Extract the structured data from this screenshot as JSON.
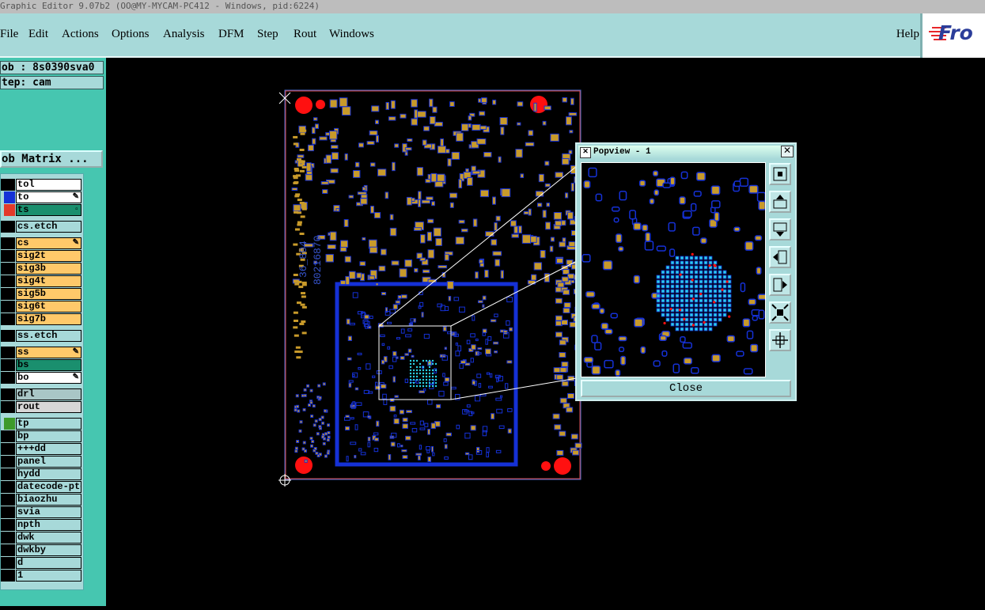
{
  "window": {
    "title": "Graphic Editor 9.07b2 (OO@MY-MYCAM-PC412 - Windows, pid:6224)"
  },
  "menu": {
    "items": [
      "File",
      "Edit",
      "Actions",
      "Options",
      "Analysis",
      "DFM",
      "Step",
      "Rout",
      "Windows"
    ],
    "help": "Help"
  },
  "logo": {
    "text": "Fro"
  },
  "job": {
    "name": "ob : 8s0390sva0",
    "step": "tep: cam",
    "matrix_button": "ob Matrix ..."
  },
  "layers": [
    {
      "name": "tol",
      "bg": "#ffffff",
      "swatch": "#000000"
    },
    {
      "name": "to",
      "bg": "#ffffff",
      "swatch": "#1531d6",
      "mark": "✎"
    },
    {
      "name": "ts",
      "bg": "#1a8f6e",
      "swatch": "#e23a2a",
      "mark": "▫"
    },
    {
      "name": "cs.etch",
      "bg": "#a7d9d9",
      "swatch": "#000000"
    },
    {
      "name": "cs",
      "bg": "#ffc96a",
      "swatch": "#000000",
      "mark": "✎"
    },
    {
      "name": "sig2t",
      "bg": "#ffc96a",
      "swatch": "#000000"
    },
    {
      "name": "sig3b",
      "bg": "#ffc96a",
      "swatch": "#000000"
    },
    {
      "name": "sig4t",
      "bg": "#ffc96a",
      "swatch": "#000000"
    },
    {
      "name": "sig5b",
      "bg": "#ffc96a",
      "swatch": "#000000"
    },
    {
      "name": "sig6t",
      "bg": "#ffc96a",
      "swatch": "#000000"
    },
    {
      "name": "sig7b",
      "bg": "#ffc96a",
      "swatch": "#000000"
    },
    {
      "name": "ss.etch",
      "bg": "#a7d9d9",
      "swatch": "#000000"
    },
    {
      "name": "ss",
      "bg": "#ffc96a",
      "swatch": "#000000",
      "mark": "✎"
    },
    {
      "name": "bs",
      "bg": "#1a8f6e",
      "swatch": "#000000"
    },
    {
      "name": "bo",
      "bg": "#ffffff",
      "swatch": "#000000",
      "mark": "✎"
    },
    {
      "name": "drl",
      "bg": "#a9c6c6",
      "swatch": "#000000"
    },
    {
      "name": "rout",
      "bg": "#d7d7d7",
      "swatch": "#000000"
    },
    {
      "name": "tp",
      "bg": "#a7d9d9",
      "swatch": "#3d9a2a"
    },
    {
      "name": "bp",
      "bg": "#a7d9d9",
      "swatch": "#000000"
    },
    {
      "name": "+++dd",
      "bg": "#a7d9d9",
      "swatch": "#000000"
    },
    {
      "name": "panel",
      "bg": "#a7d9d9",
      "swatch": "#000000"
    },
    {
      "name": "hydd",
      "bg": "#a7d9d9",
      "swatch": "#000000"
    },
    {
      "name": "datecode-pte",
      "bg": "#a7d9d9",
      "swatch": "#000000"
    },
    {
      "name": "biaozhu",
      "bg": "#a7d9d9",
      "swatch": "#000000"
    },
    {
      "name": "svia",
      "bg": "#a7d9d9",
      "swatch": "#000000"
    },
    {
      "name": "npth",
      "bg": "#a7d9d9",
      "swatch": "#000000"
    },
    {
      "name": "dwk",
      "bg": "#a7d9d9",
      "swatch": "#000000"
    },
    {
      "name": "dwkby",
      "bg": "#a7d9d9",
      "swatch": "#000000"
    },
    {
      "name": "d",
      "bg": "#a7d9d9",
      "swatch": "#000000"
    },
    {
      "name": "1",
      "bg": "#a7d9d9",
      "swatch": "#000000"
    }
  ],
  "board": {
    "label_1": "36_804",
    "label_2": "80216870"
  },
  "popview": {
    "title": "Popview - 1",
    "close_button": "Close"
  },
  "colors": {
    "pad": "#c89a2a",
    "trace": "#1531d6",
    "via": "#2bd3e6",
    "fiducial": "#ff1010",
    "panel": "#a7d9d9"
  }
}
